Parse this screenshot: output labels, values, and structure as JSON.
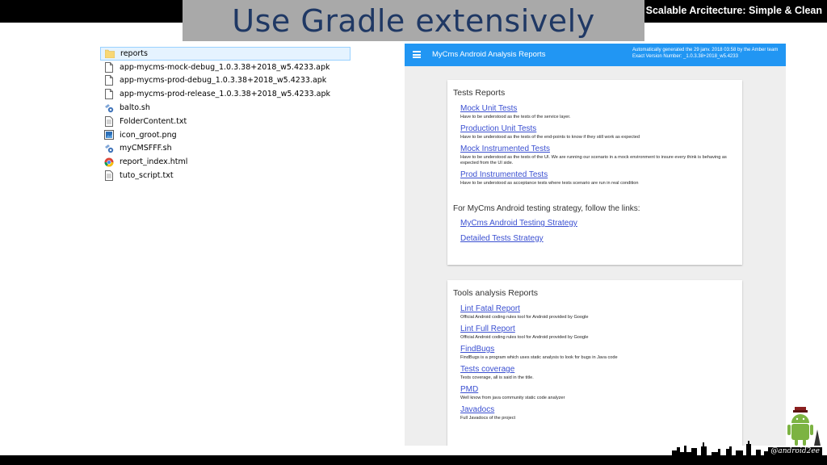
{
  "slide": {
    "title": "Use Gradle extensively",
    "brand": "Scalable Arcitecture: Simple & Clean",
    "handle": "@android2ee"
  },
  "explorer": {
    "files": [
      {
        "name": "reports",
        "icon": "folder-icon"
      },
      {
        "name": "app-mycms-mock-debug_1.0.3.38+2018_w5.4233.apk",
        "icon": "file-icon"
      },
      {
        "name": "app-mycms-prod-debug_1.0.3.38+2018_w5.4233.apk",
        "icon": "file-icon"
      },
      {
        "name": "app-mycms-prod-release_1.0.3.38+2018_w5.4233.apk",
        "icon": "file-icon"
      },
      {
        "name": "balto.sh",
        "icon": "script-icon"
      },
      {
        "name": "FolderContent.txt",
        "icon": "text-file-icon"
      },
      {
        "name": "icon_groot.png",
        "icon": "image-file-icon"
      },
      {
        "name": "myCMSFFF.sh",
        "icon": "script-icon"
      },
      {
        "name": "report_index.html",
        "icon": "chrome-icon"
      },
      {
        "name": "tuto_script.txt",
        "icon": "text-file-icon"
      }
    ]
  },
  "report": {
    "header_title": "MyCms Android Analysis Reports",
    "meta_line1": "Automatically generated the 29 janv. 2018 03:58 by the Amber team",
    "meta_line2": "Exact Version Number: _1.0.3.38+2018_w5.4233",
    "tests_card": {
      "heading": "Tests Reports",
      "items": [
        {
          "label": "Mock Unit Tests",
          "desc": "Have to be understood as the tests of the service layer."
        },
        {
          "label": "Production Unit Tests",
          "desc": "Have to be understood as the tests of the end-points to know if they still work as expected"
        },
        {
          "label": "Mock Instrumented Tests",
          "desc": "Have to be understood as the tests of the UI. We are running our scenario in a mock environment to insure every think is behaving as expected from the UI side."
        },
        {
          "label": "Prod Instrumented Tests",
          "desc": "Have to be understood as acceptance tests where tests scenario are run in real condition"
        }
      ],
      "strategy_heading": "For MyCms Android testing strategy, follow the links:",
      "strategy_links": [
        "MyCms Android Testing Strategy",
        "Detailed Tests Strategy"
      ]
    },
    "tools_card": {
      "heading": "Tools analysis Reports",
      "items": [
        {
          "label": "Lint Fatal Report",
          "desc": "Official Android coding rules tool for Android provided by Google"
        },
        {
          "label": "Lint Full Report",
          "desc": "Official Android coding rules tool for Android provided by Google"
        },
        {
          "label": "FindBugs",
          "desc": "FindBugs is a program which uses static analysis to look for bugs in Java code"
        },
        {
          "label": "Tests coverage",
          "desc": "Tests coverage, all is said in the title."
        },
        {
          "label": "PMD",
          "desc": "Well know from java community static code analyzer"
        },
        {
          "label": "Javadocs",
          "desc": "Full Javadocs of the project"
        }
      ]
    }
  },
  "colors": {
    "header_blue": "#2196f3",
    "link_blue": "#3a4fd1",
    "title_navy": "#1f3864"
  }
}
